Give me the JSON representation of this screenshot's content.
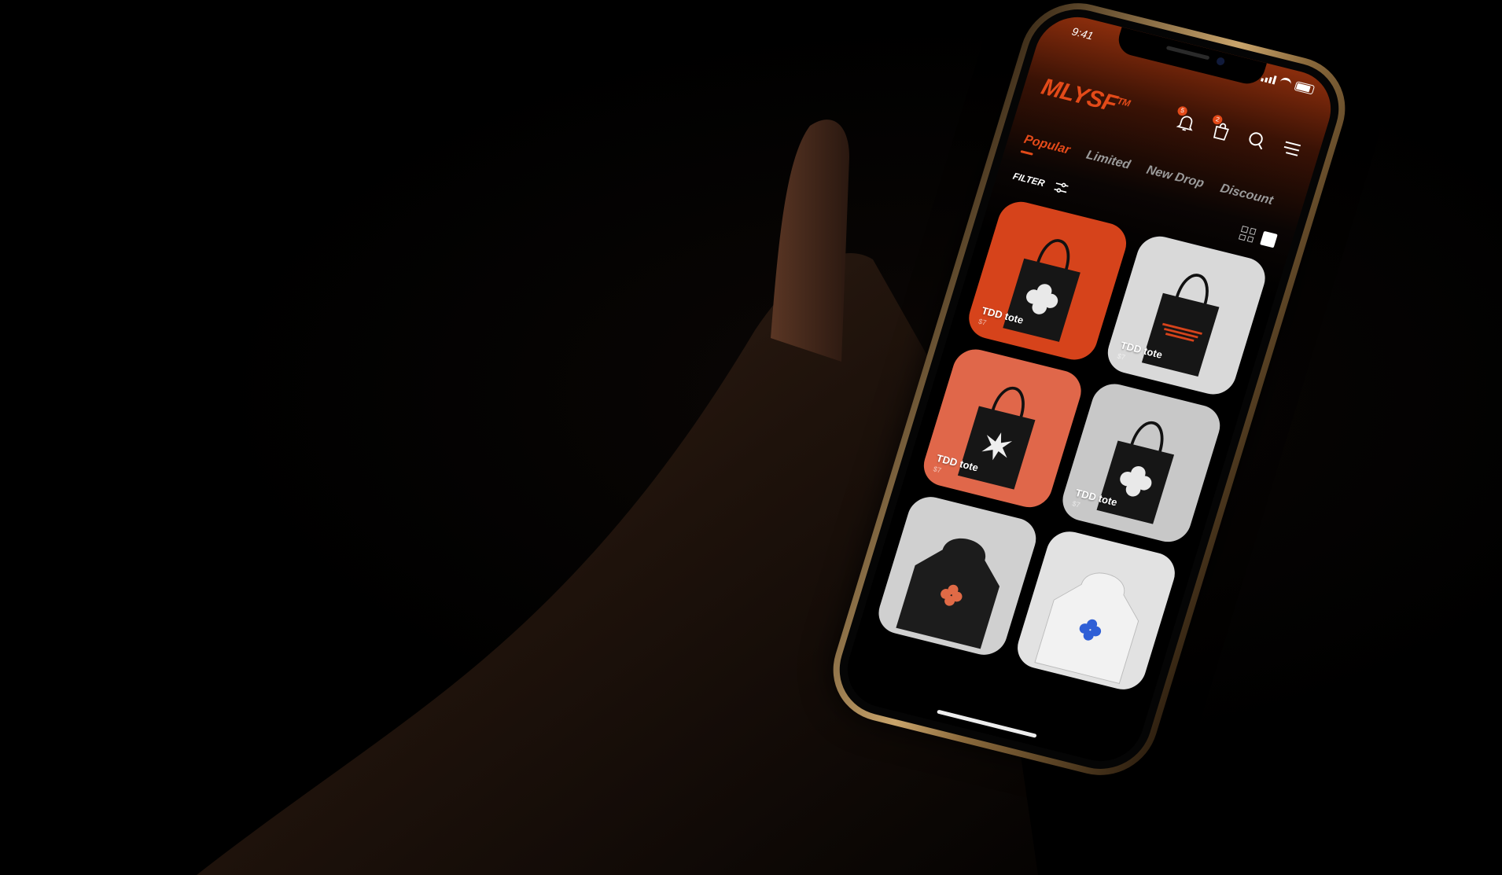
{
  "status_bar": {
    "time": "9:41"
  },
  "header": {
    "logo": "MLYSF",
    "logo_mark": "TM",
    "icons": {
      "notifications": {
        "name": "bell-icon",
        "badge": "5"
      },
      "cart": {
        "name": "shopping-bag-icon",
        "badge": "2"
      },
      "search": {
        "name": "search-icon"
      },
      "menu": {
        "name": "hamburger-menu-icon"
      }
    }
  },
  "tabs": [
    {
      "label": "Popular",
      "active": true
    },
    {
      "label": "Limited",
      "active": false
    },
    {
      "label": "New Drop",
      "active": false
    },
    {
      "label": "Discount",
      "active": false
    }
  ],
  "toolbar": {
    "filter_label": "FILTER"
  },
  "products": [
    {
      "name": "TDD tote",
      "price": "$7",
      "bg": "#d6431b",
      "print": "flower"
    },
    {
      "name": "TDD tote",
      "price": "$7",
      "bg": "#d9d9d9",
      "print": "text"
    },
    {
      "name": "TDD tote",
      "price": "$7",
      "bg": "#e0674a",
      "print": "star"
    },
    {
      "name": "TDD tote",
      "price": "$7",
      "bg": "#c8c8c8",
      "print": "flower"
    },
    {
      "name": "",
      "price": "",
      "bg": "#d0d0d0",
      "print": "hoodie-black"
    },
    {
      "name": "",
      "price": "",
      "bg": "#e2e2e2",
      "print": "hoodie-white"
    }
  ],
  "colors": {
    "accent": "#e34a19",
    "background": "#000000"
  }
}
